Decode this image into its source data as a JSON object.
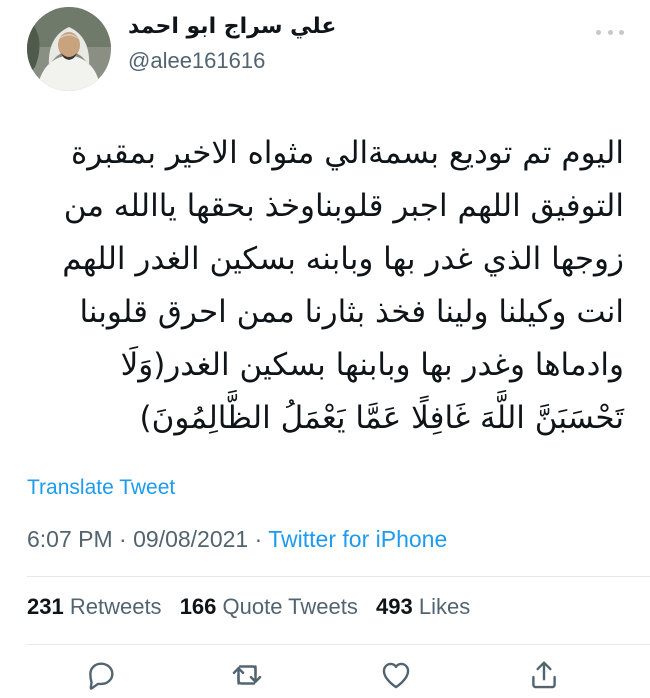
{
  "author": {
    "display_name": "علي سراج  ابو احمد",
    "username": "@alee161616",
    "avatar_icon": "profile-photo"
  },
  "tweet": {
    "lines": [
      "اليوم تم توديع بسمةالي مثواه الاخير بمقبرة",
      "التوفيق اللهم اجبر  قلوبناوخذ بحقها ياالله من",
      "زوجها الذي غدر بها وبابنه بسكين الغدر اللهم",
      "انت وكيلنا ولينا فخذ بثارنا ممن احرق قلوبنا",
      "وادماها وغدر بها وبابنها بسكين الغدر(وَلَا",
      "تَحْسَبَنَّ اللَّهَ غَافِلًا عَمَّا يَعْمَلُ الظَّالِمُونَ)"
    ],
    "translate_label": "Translate Tweet",
    "time": "6:07 PM",
    "separator": " · ",
    "date": "09/08/2021",
    "source": "Twitter for iPhone"
  },
  "stats": {
    "retweets_count": "231",
    "retweets_label": "Retweets",
    "quotes_count": "166",
    "quotes_label": "Quote Tweets",
    "likes_count": "493",
    "likes_label": "Likes"
  },
  "actions": {
    "reply_icon": "reply-icon",
    "retweet_icon": "retweet-icon",
    "like_icon": "heart-icon",
    "share_icon": "share-icon"
  },
  "colors": {
    "link": "#1d9bf0",
    "secondary": "#536471",
    "primary": "#0f1419",
    "divider": "#e6e8ea"
  }
}
